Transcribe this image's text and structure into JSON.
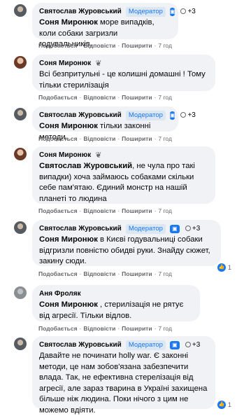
{
  "comments": [
    {
      "author": "Святослав Журовський",
      "role": "Модератор",
      "plus": "+3",
      "mention": "Соня Миронюк",
      "text": " море випадків, коли собаки загризли годувальників.",
      "actions": {
        "like": "Подобається",
        "reply": "Відповісти",
        "share": "Поширити",
        "time": "7 год"
      }
    },
    {
      "author": "Соня Миронюк",
      "mention": "",
      "text": "Всі безпритульні - це колишні домашні ! Тому тільки стерилізація",
      "actions": {
        "like": "Подобається",
        "reply": "Відповісти",
        "share": "Поширити",
        "time": "7 год"
      }
    },
    {
      "author": "Святослав Журовський",
      "role": "Модератор",
      "plus": "+3",
      "mention": "Соня Миронюк",
      "text": " тільки законні методи.",
      "actions": {
        "like": "Подобається",
        "reply": "Відповісти",
        "share": "Поширити",
        "time": "7 год"
      }
    },
    {
      "author": "Соня Миронюк",
      "mention": "Святослав Журовський",
      "text": ", не чула про такі випадки) хоча займаюсь собаками скільки себе пам'ятаю. Єдиний монстр на нашій планеті то людина",
      "actions": {
        "like": "Подобається",
        "reply": "Відповісти",
        "share": "Поширити",
        "time": "7 год"
      }
    },
    {
      "author": "Святослав Журовський",
      "role": "Модератор",
      "plus": "+3",
      "mention": "Соня Миронюк",
      "text": " в Києві годувальниці собаки відгризли повністю обидві руки. Знайду сюжет, закину сюди.",
      "actions": {
        "like": "Подобається",
        "reply": "Відповісти",
        "share": "Поширити",
        "time": "7 год"
      },
      "like_count": "1"
    },
    {
      "author": "Аня Фроляк",
      "mention": "Соня Миронюк",
      "text": " , стерилізація не рятує від агресії. Тільки відлов.",
      "actions": {
        "like": "Подобається",
        "reply": "Відповісти",
        "share": "Поширити",
        "time": "7 год"
      }
    },
    {
      "author": "Святослав Журовський",
      "role": "Модератор",
      "plus": "+3",
      "mention": "",
      "text": "Давайте не починати holly war. Є законні методи, це нам зобов'язана забезпечити влада. Так, не ефективна стерелізація від агресії, але зараз тварина в Україні захищена більше ніж людина. Поки нічого з цим не можемо вдіяти.",
      "like_count": "1"
    }
  ],
  "colors": {
    "bubble": "#f0f2f5",
    "accent": "#1877f2",
    "meta": "#65676b"
  }
}
